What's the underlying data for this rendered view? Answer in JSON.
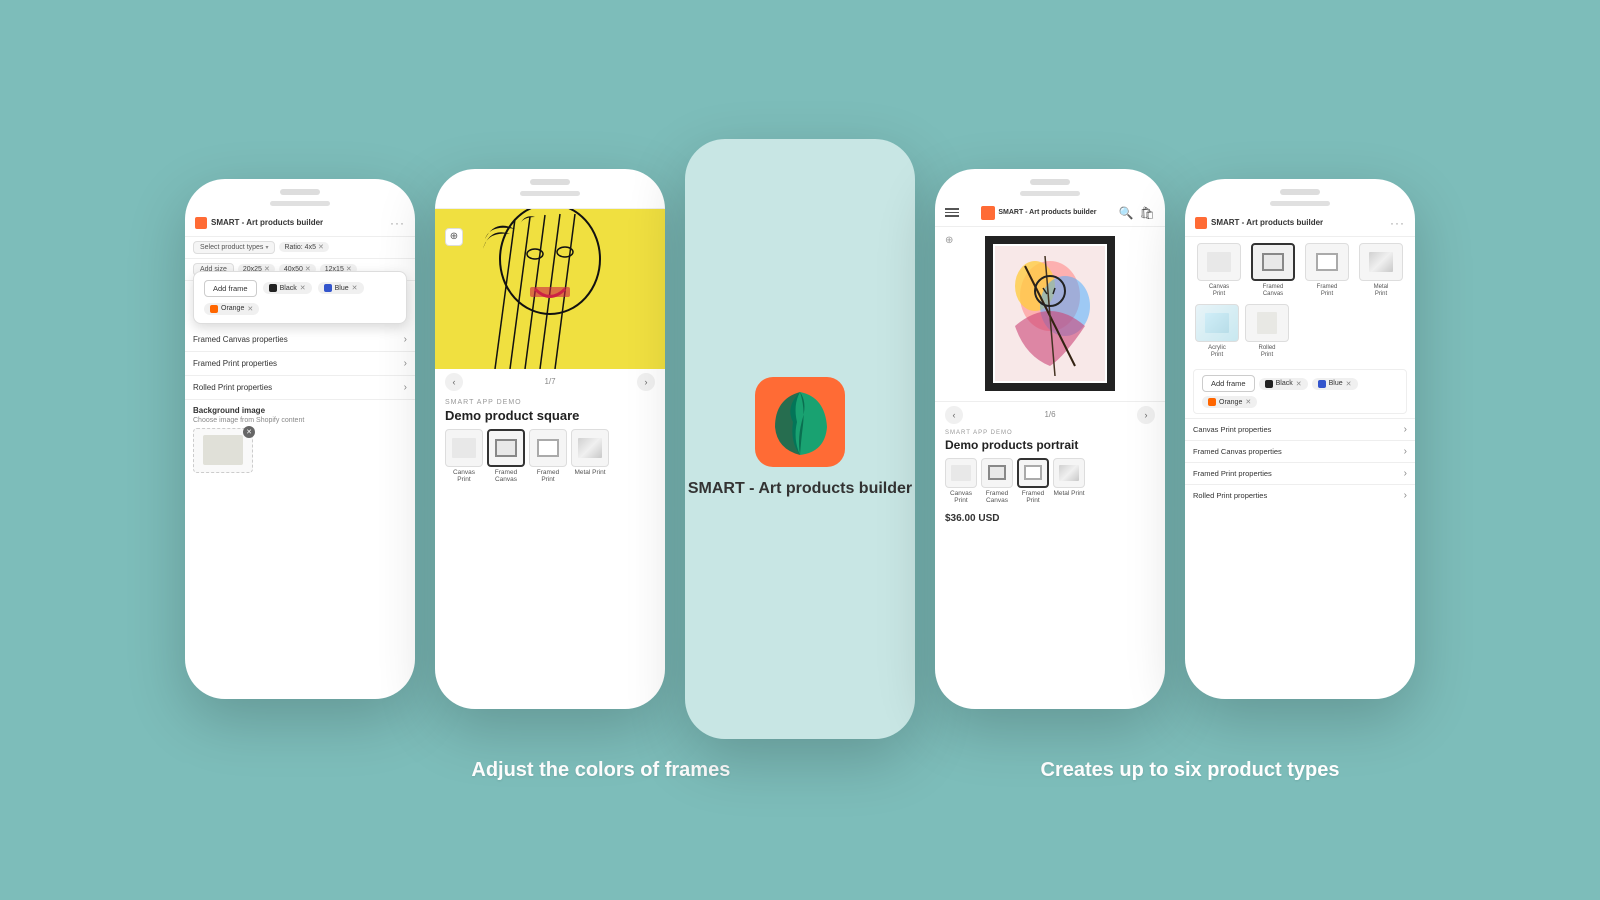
{
  "background_color": "#7dbdba",
  "phones": {
    "phone1": {
      "title": "SMART - Art products builder",
      "filter": {
        "product_type_btn": "Select product types",
        "ratio_tag": "Ratio: 4x5",
        "add_size_btn": "Add size",
        "sizes": [
          "20x25",
          "40x50",
          "12x15"
        ]
      },
      "frame_popup": {
        "add_frame_btn": "Add frame",
        "colors": [
          {
            "name": "Black",
            "color": "#222222"
          },
          {
            "name": "Blue",
            "color": "#3355cc"
          },
          {
            "name": "Orange",
            "color": "#ff6600"
          }
        ]
      },
      "properties": [
        {
          "label": "Framed Canvas properties"
        },
        {
          "label": "Framed Print properties"
        },
        {
          "label": "Rolled Print properties"
        }
      ],
      "bg_image": {
        "title": "Background image",
        "subtitle": "Choose image from Shopify content"
      }
    },
    "phone2": {
      "page": "1/7",
      "demo_tag": "SMART APP DEMO",
      "product_title": "Demo product square",
      "types": [
        {
          "label": "Canvas Print",
          "selected": false
        },
        {
          "label": "Framed Canvas",
          "selected": true
        },
        {
          "label": "Framed Print",
          "selected": false
        },
        {
          "label": "Metal Print",
          "selected": false
        }
      ]
    },
    "phone_center": {
      "app_name": "SMART - Art products builder"
    },
    "phone4": {
      "page": "1/6",
      "demo_tag": "SMART APP DEMO",
      "product_title": "Demo products portrait",
      "types": [
        {
          "label": "Canvas Print",
          "selected": false
        },
        {
          "label": "Framed Canvas",
          "selected": false
        },
        {
          "label": "Framed Print",
          "selected": true
        },
        {
          "label": "Metal Print",
          "selected": false
        }
      ],
      "price": "$36.00 USD"
    },
    "phone5": {
      "title": "SMART - Art products builder",
      "product_grid_row1": [
        {
          "label": "Canvas Print",
          "selected": false
        },
        {
          "label": "Framed Canvas",
          "selected": true
        },
        {
          "label": "Framed Print",
          "selected": false
        },
        {
          "label": "Metal Print",
          "selected": false
        }
      ],
      "product_grid_row2": [
        {
          "label": "Acrylic Print",
          "selected": false
        },
        {
          "label": "Rolled Print",
          "selected": false
        }
      ],
      "frame_colors": [
        "Black",
        "Blue",
        "Orange"
      ],
      "properties": [
        {
          "label": "Canvas Print properties"
        },
        {
          "label": "Framed Canvas properties"
        },
        {
          "label": "Framed Print properties"
        },
        {
          "label": "Rolled Print properties"
        }
      ]
    }
  },
  "captions": {
    "left": "Adjust the colors of  frames",
    "right": "Creates up to six product types"
  }
}
